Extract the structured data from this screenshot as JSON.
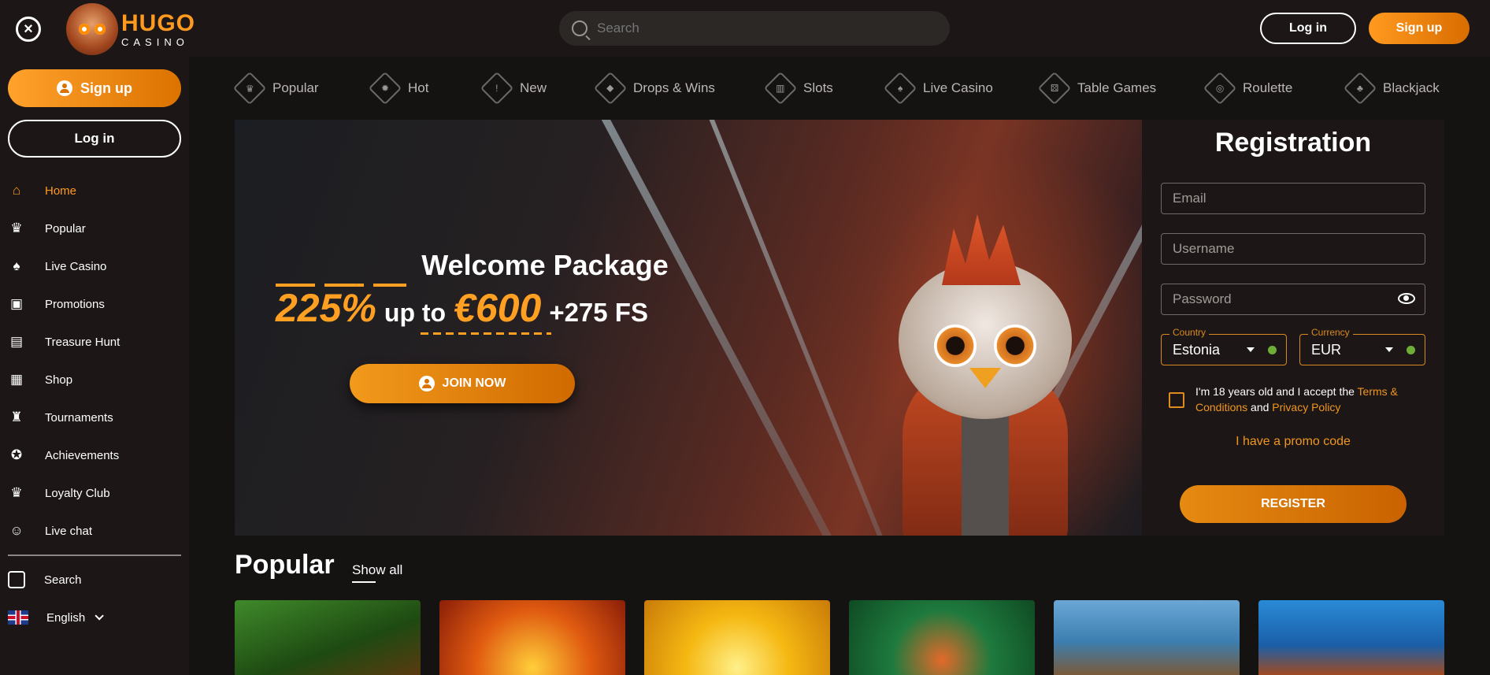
{
  "header": {
    "logo_main": "HUGO",
    "logo_sub": "CASINO",
    "search_placeholder": "Search",
    "login_label": "Log in",
    "signup_label": "Sign up"
  },
  "sidebar": {
    "signup_label": "Sign up",
    "login_label": "Log in",
    "items": [
      {
        "label": "Home",
        "icon": "home-icon",
        "active": true
      },
      {
        "label": "Popular",
        "icon": "crown-icon"
      },
      {
        "label": "Live Casino",
        "icon": "cards-icon"
      },
      {
        "label": "Promotions",
        "icon": "gift-icon"
      },
      {
        "label": "Treasure Hunt",
        "icon": "chest-icon"
      },
      {
        "label": "Shop",
        "icon": "shop-icon"
      },
      {
        "label": "Tournaments",
        "icon": "trophy-icon"
      },
      {
        "label": "Achievements",
        "icon": "medal-icon"
      },
      {
        "label": "Loyalty Club",
        "icon": "crown-icon"
      },
      {
        "label": "Live chat",
        "icon": "chat-icon"
      }
    ],
    "search_label": "Search",
    "language_label": "English"
  },
  "categories": [
    {
      "label": "Popular",
      "icon": "crown-icon"
    },
    {
      "label": "Hot",
      "icon": "flame-icon"
    },
    {
      "label": "New",
      "icon": "exclamation-icon"
    },
    {
      "label": "Drops & Wins",
      "icon": "drops-icon"
    },
    {
      "label": "Slots",
      "icon": "slot-machine-icon"
    },
    {
      "label": "Live Casino",
      "icon": "cards-icon"
    },
    {
      "label": "Table Games",
      "icon": "dice-icon"
    },
    {
      "label": "Roulette",
      "icon": "roulette-icon"
    },
    {
      "label": "Blackjack",
      "icon": "blackjack-icon"
    }
  ],
  "hero": {
    "title": "Welcome Package",
    "percent": "225%",
    "up_to": "up to",
    "amount": "€600",
    "free_spins": "+275 FS",
    "join_label": "JOIN NOW"
  },
  "registration": {
    "title": "Registration",
    "email_placeholder": "Email",
    "username_placeholder": "Username",
    "password_placeholder": "Password",
    "country_label": "Country",
    "country_value": "Estonia",
    "currency_label": "Currency",
    "currency_value": "EUR",
    "terms_prefix": "I'm 18 years old and I accept the",
    "terms_link": "Terms & Conditions",
    "terms_and": "and",
    "privacy_link": "Privacy Policy",
    "promo_label": "I have a promo code",
    "register_label": "REGISTER"
  },
  "popular": {
    "title": "Popular",
    "show_all": "Show all"
  },
  "colors": {
    "accent": "#ff9a1f",
    "background": "#151212",
    "panel": "#1c1716"
  }
}
